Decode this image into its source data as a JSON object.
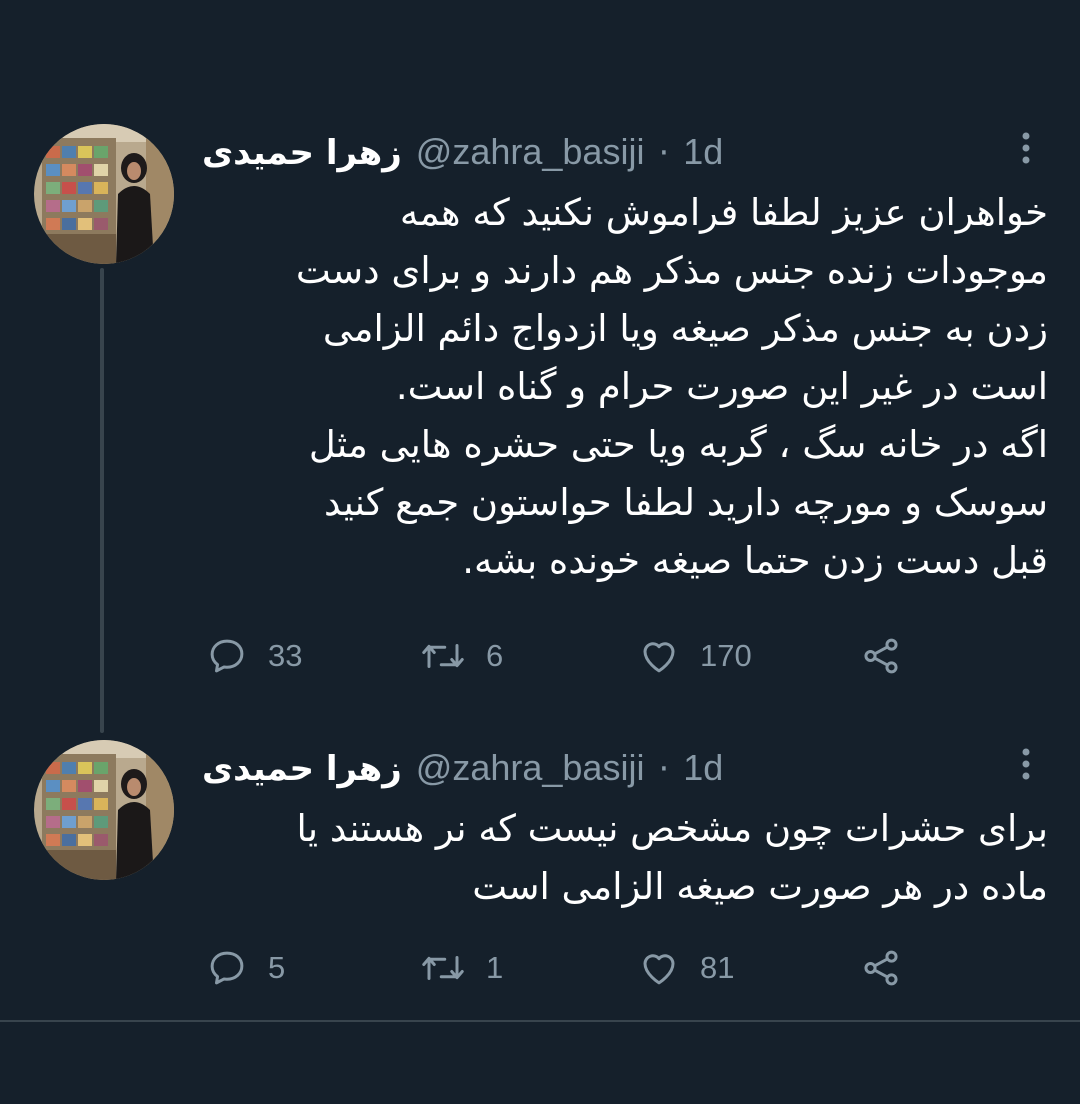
{
  "tweets": [
    {
      "author_name": "زهرا حمیدی",
      "handle": "@zahra_basiji",
      "separator": "·",
      "time": "1d",
      "lines": [
        "خواهران عزیز لطفا فراموش نکنید که همه",
        "موجودات زنده جنس مذکر هم دارند و برای دست",
        "زدن به جنس مذکر صیغه ویا ازدواج دائم الزامی",
        "است در غیر این صورت حرام و گناه است.",
        "اگه در خانه سگ ، گربه ویا حتی حشره هایی مثل",
        "سوسک و مورچه دارید لطفا حواستون جمع کنید",
        "قبل دست زدن حتما صیغه خونده بشه."
      ],
      "replies": "33",
      "retweets": "6",
      "likes": "170"
    },
    {
      "author_name": "زهرا حمیدی",
      "handle": "@zahra_basiji",
      "separator": "·",
      "time": "1d",
      "lines": [
        "برای حشرات چون مشخص نیست که نر هستند یا",
        "ماده در هر صورت صیغه الزامی است"
      ],
      "replies": "5",
      "retweets": "1",
      "likes": "81"
    }
  ],
  "icons": {
    "reply": "reply-icon",
    "retweet": "retweet-icon",
    "like": "heart-icon",
    "share": "share-icon",
    "more": "more-vertical-icon",
    "avatar": "profile-photo"
  },
  "colors": {
    "background": "#15202b",
    "text": "#ffffff",
    "secondary": "#8899a6",
    "divider": "#38444d"
  }
}
